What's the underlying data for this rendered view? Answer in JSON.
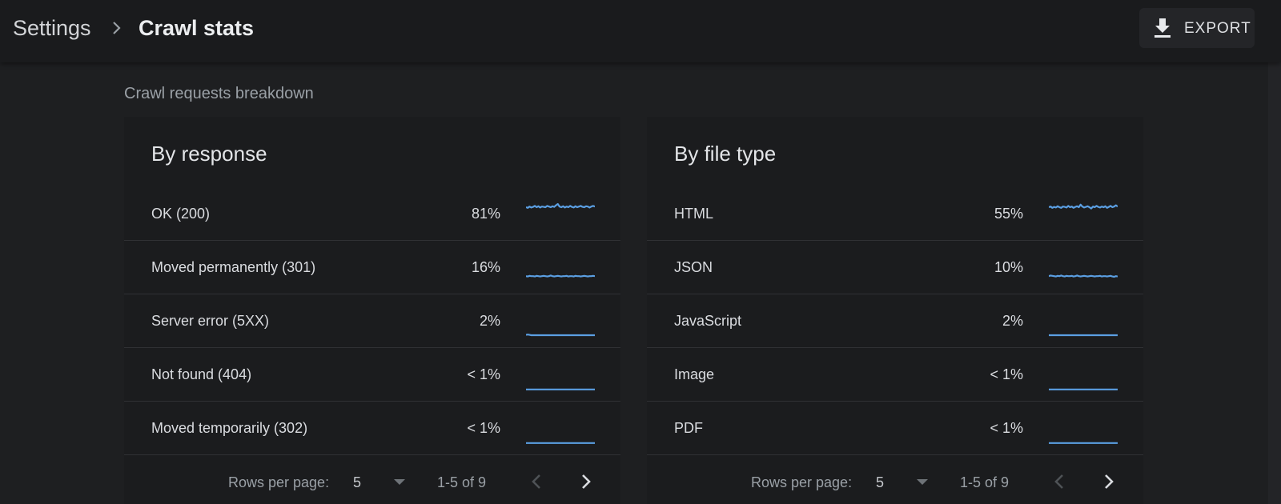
{
  "header": {
    "breadcrumb_root": "Settings",
    "breadcrumb_current": "Crawl stats",
    "export_label": "EXPORT",
    "export_icon": "download-icon",
    "separator_icon": "chevron-right-icon"
  },
  "section": {
    "title": "Crawl requests breakdown"
  },
  "colors": {
    "sparkline": "#5b9fe3",
    "background": "#1e1f21",
    "card": "#1b1c1e"
  },
  "cards": [
    {
      "title": "By response",
      "rows": [
        {
          "label": "OK (200)",
          "percent": "81%",
          "trend": [
            0.7,
            0.68,
            0.72,
            0.69,
            0.71,
            0.74,
            0.7,
            0.73,
            0.69,
            0.72,
            0.71,
            0.7,
            0.74,
            0.72,
            0.7,
            0.73,
            0.71,
            0.76,
            0.8,
            0.72,
            0.7,
            0.73,
            0.69,
            0.72,
            0.7,
            0.74,
            0.71,
            0.69,
            0.73,
            0.7,
            0.72,
            0.74,
            0.71,
            0.7,
            0.73,
            0.72,
            0.69,
            0.72,
            0.74,
            0.72
          ]
        },
        {
          "label": "Moved permanently (301)",
          "percent": "16%",
          "trend": [
            0.22,
            0.21,
            0.23,
            0.22,
            0.22,
            0.21,
            0.23,
            0.22,
            0.21,
            0.22,
            0.23,
            0.22,
            0.21,
            0.22,
            0.24,
            0.22,
            0.21,
            0.22,
            0.23,
            0.22,
            0.21,
            0.22,
            0.22,
            0.23,
            0.21,
            0.22,
            0.22,
            0.21,
            0.23,
            0.22,
            0.22,
            0.21,
            0.22,
            0.23,
            0.22,
            0.21,
            0.22,
            0.22,
            0.23,
            0.22
          ]
        },
        {
          "label": "Server error (5XX)",
          "percent": "2%",
          "trend": [
            0.06,
            0.07,
            0.06,
            0.05,
            0.05,
            0.05,
            0.05,
            0.05,
            0.05,
            0.05,
            0.05,
            0.05,
            0.05,
            0.05,
            0.05,
            0.05,
            0.05,
            0.05,
            0.05,
            0.05,
            0.05,
            0.05,
            0.05,
            0.05,
            0.05,
            0.05,
            0.05,
            0.05,
            0.05,
            0.05,
            0.05,
            0.05,
            0.05,
            0.05,
            0.05,
            0.05,
            0.05,
            0.05,
            0.05,
            0.05
          ]
        },
        {
          "label": "Not found (404)",
          "percent": "< 1%",
          "trend": [
            0.03,
            0.03,
            0.03,
            0.03,
            0.03,
            0.03,
            0.03,
            0.03,
            0.03,
            0.03,
            0.03,
            0.03,
            0.03,
            0.03,
            0.03,
            0.03,
            0.03,
            0.03,
            0.03,
            0.03,
            0.03,
            0.03,
            0.03,
            0.03,
            0.03,
            0.03,
            0.03,
            0.03,
            0.03,
            0.03,
            0.03,
            0.03,
            0.03,
            0.03,
            0.03,
            0.03,
            0.03,
            0.03,
            0.03,
            0.03
          ]
        },
        {
          "label": "Moved temporarily (302)",
          "percent": "< 1%",
          "trend": [
            0.03,
            0.03,
            0.03,
            0.03,
            0.03,
            0.03,
            0.03,
            0.03,
            0.03,
            0.03,
            0.03,
            0.03,
            0.03,
            0.03,
            0.03,
            0.03,
            0.03,
            0.03,
            0.03,
            0.03,
            0.03,
            0.03,
            0.03,
            0.03,
            0.03,
            0.03,
            0.03,
            0.03,
            0.03,
            0.03,
            0.03,
            0.03,
            0.03,
            0.03,
            0.03,
            0.03,
            0.03,
            0.03,
            0.03,
            0.03
          ]
        }
      ],
      "pagination": {
        "rows_per_page_label": "Rows per page:",
        "rows_per_page": "5",
        "range": "1-5 of 9"
      }
    },
    {
      "title": "By file type",
      "rows": [
        {
          "label": "HTML",
          "percent": "55%",
          "trend": [
            0.7,
            0.72,
            0.68,
            0.71,
            0.69,
            0.73,
            0.7,
            0.68,
            0.72,
            0.71,
            0.69,
            0.74,
            0.7,
            0.72,
            0.68,
            0.71,
            0.73,
            0.7,
            0.78,
            0.72,
            0.69,
            0.71,
            0.73,
            0.7,
            0.66,
            0.72,
            0.7,
            0.74,
            0.71,
            0.69,
            0.72,
            0.7,
            0.73,
            0.68,
            0.71,
            0.74,
            0.7,
            0.72,
            0.76,
            0.72
          ]
        },
        {
          "label": "JSON",
          "percent": "10%",
          "trend": [
            0.22,
            0.24,
            0.23,
            0.22,
            0.21,
            0.23,
            0.22,
            0.24,
            0.22,
            0.21,
            0.23,
            0.22,
            0.22,
            0.23,
            0.21,
            0.22,
            0.24,
            0.22,
            0.21,
            0.22,
            0.23,
            0.22,
            0.21,
            0.22,
            0.23,
            0.22,
            0.21,
            0.22,
            0.22,
            0.23,
            0.21,
            0.22,
            0.22,
            0.21,
            0.22,
            0.23,
            0.21,
            0.2,
            0.22,
            0.21
          ]
        },
        {
          "label": "JavaScript",
          "percent": "2%",
          "trend": [
            0.05,
            0.05,
            0.05,
            0.05,
            0.05,
            0.05,
            0.05,
            0.05,
            0.05,
            0.05,
            0.05,
            0.05,
            0.05,
            0.05,
            0.05,
            0.05,
            0.05,
            0.05,
            0.05,
            0.05,
            0.05,
            0.05,
            0.05,
            0.05,
            0.05,
            0.05,
            0.05,
            0.05,
            0.05,
            0.05,
            0.05,
            0.05,
            0.05,
            0.05,
            0.05,
            0.05,
            0.05,
            0.05,
            0.05,
            0.05
          ]
        },
        {
          "label": "Image",
          "percent": "< 1%",
          "trend": [
            0.03,
            0.03,
            0.03,
            0.03,
            0.03,
            0.03,
            0.03,
            0.03,
            0.03,
            0.03,
            0.03,
            0.03,
            0.03,
            0.03,
            0.03,
            0.03,
            0.03,
            0.03,
            0.03,
            0.03,
            0.03,
            0.03,
            0.03,
            0.03,
            0.03,
            0.03,
            0.03,
            0.03,
            0.03,
            0.03,
            0.03,
            0.03,
            0.03,
            0.03,
            0.03,
            0.03,
            0.03,
            0.03,
            0.03,
            0.03
          ]
        },
        {
          "label": "PDF",
          "percent": "< 1%",
          "trend": [
            0.03,
            0.03,
            0.03,
            0.03,
            0.03,
            0.03,
            0.03,
            0.03,
            0.03,
            0.03,
            0.03,
            0.03,
            0.03,
            0.03,
            0.03,
            0.03,
            0.03,
            0.03,
            0.03,
            0.03,
            0.03,
            0.03,
            0.03,
            0.03,
            0.03,
            0.03,
            0.03,
            0.03,
            0.03,
            0.03,
            0.03,
            0.03,
            0.03,
            0.03,
            0.03,
            0.03,
            0.03,
            0.03,
            0.03,
            0.03
          ]
        }
      ],
      "pagination": {
        "rows_per_page_label": "Rows per page:",
        "rows_per_page": "5",
        "range": "1-5 of 9"
      }
    }
  ]
}
